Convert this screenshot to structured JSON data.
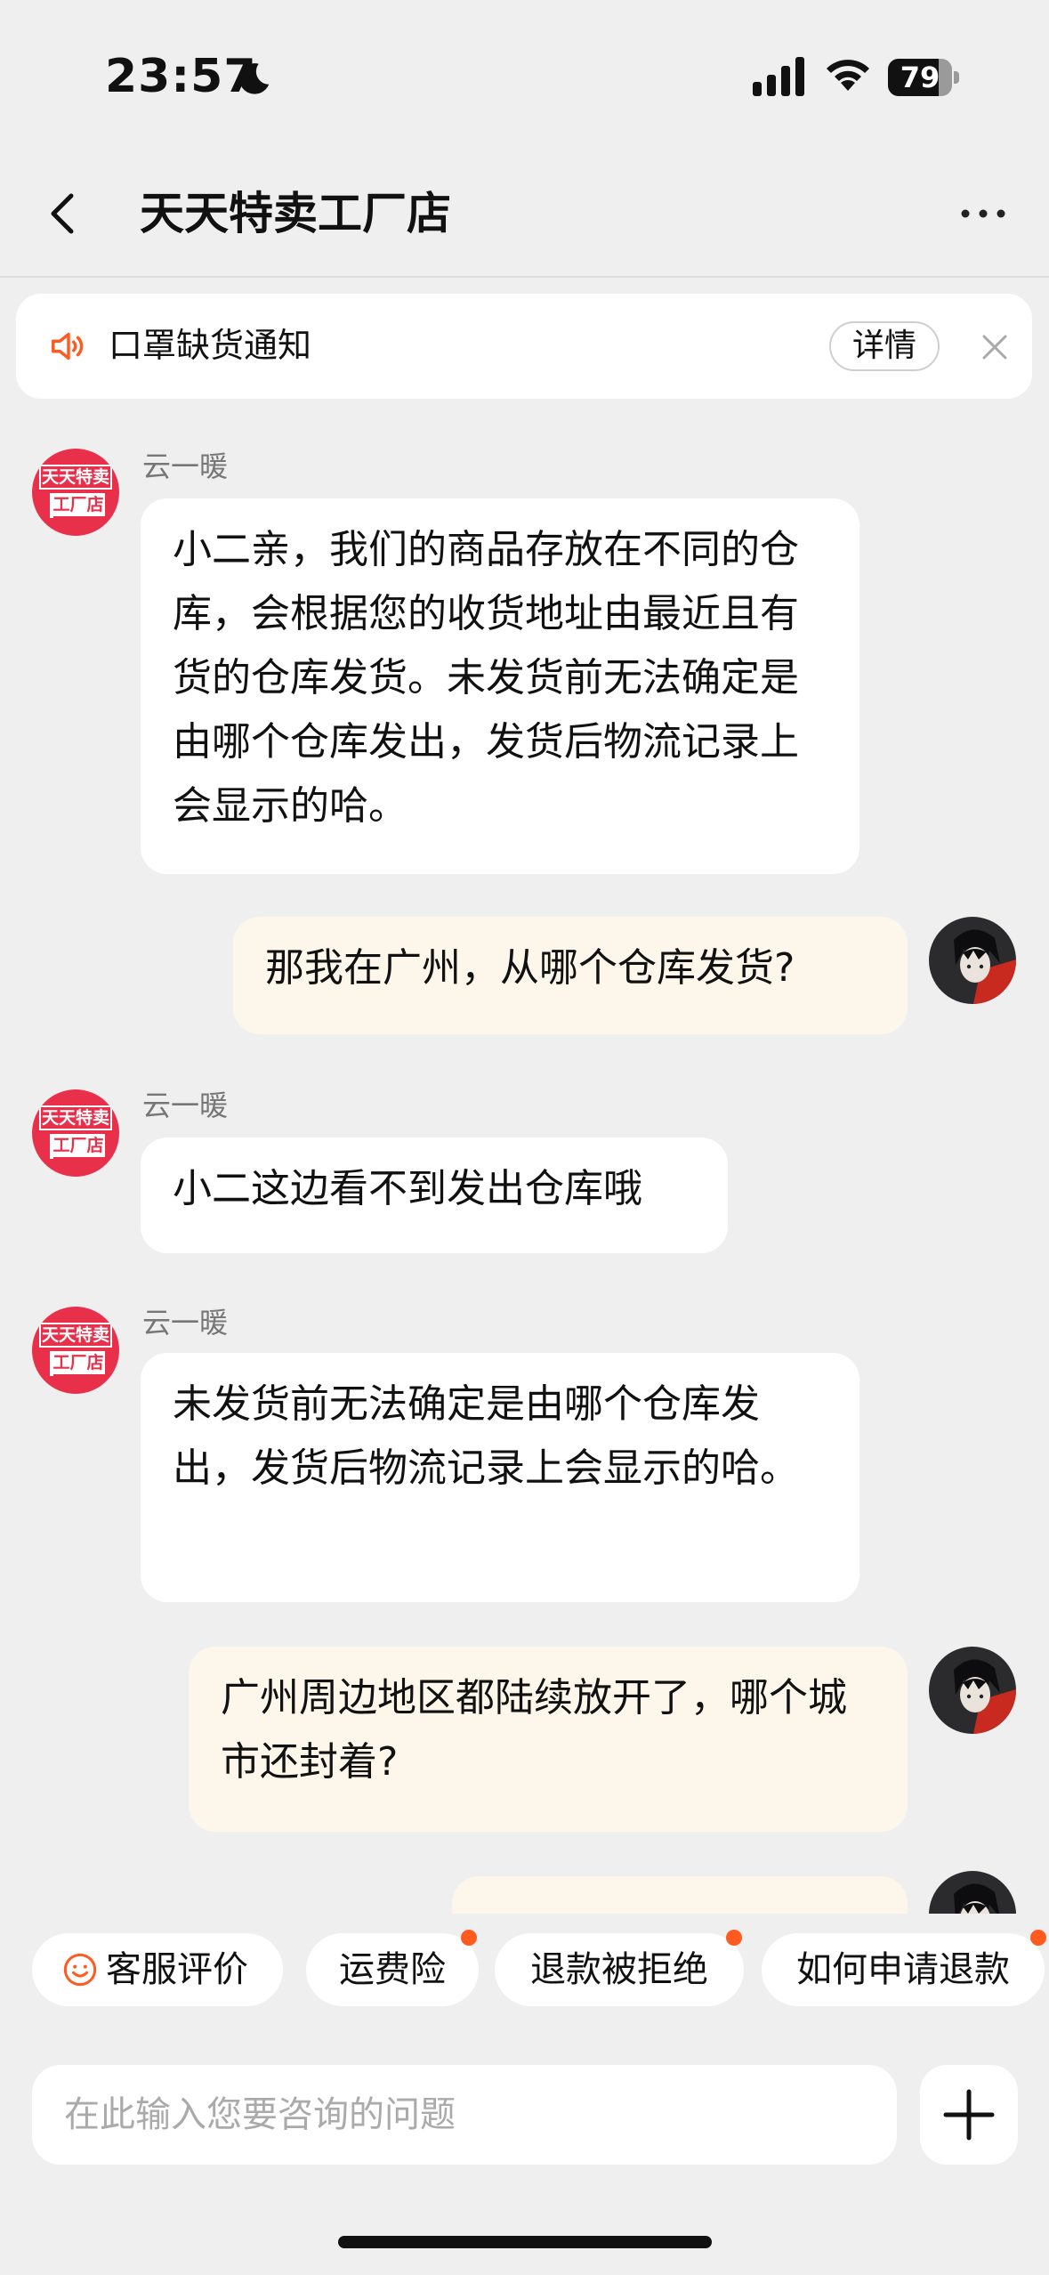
{
  "status_bar": {
    "time": "23:57",
    "battery": "79",
    "battery_level": 0.79,
    "icons": [
      "moon-icon",
      "signal-icon",
      "wifi-icon",
      "battery-icon"
    ]
  },
  "header": {
    "title": "天天特卖工厂店",
    "back_icon": "chevron-left-icon",
    "more_icon": "more-dots-icon"
  },
  "notice": {
    "text": "口罩缺货通知",
    "detail_label": "详情",
    "icon": "speaker-icon",
    "close_icon": "close-icon"
  },
  "shop": {
    "avatar_line1": "天天特卖",
    "avatar_line2": "工厂店"
  },
  "messages": [
    {
      "from": "agent",
      "sender": "云一暖",
      "text": "小二亲，我们的商品存放在不同的仓库，会根据您的收货地址由最近且有货的仓库发货。未发货前无法确定是由哪个仓库发出，发货后物流记录上会显示的哈。"
    },
    {
      "from": "user",
      "text": "那我在广州，从哪个仓库发货?"
    },
    {
      "from": "agent",
      "sender": "云一暖",
      "text": "小二这边看不到发出仓库哦"
    },
    {
      "from": "agent",
      "sender": "云一暖",
      "text": "未发货前无法确定是由哪个仓库发出，发货后物流记录上会显示的哈。"
    },
    {
      "from": "user",
      "text": "广州周边地区都陆续放开了，哪个城市还封着?"
    },
    {
      "from": "user",
      "text": ""
    }
  ],
  "quick_replies": [
    {
      "label": "客服评价",
      "icon": "smile-icon",
      "has_dot": false
    },
    {
      "label": "运费险",
      "has_dot": true
    },
    {
      "label": "退款被拒绝",
      "has_dot": true
    },
    {
      "label": "如何申请退款",
      "has_dot": true
    }
  ],
  "input": {
    "placeholder": "在此输入您要咨询的问题",
    "plus_icon": "plus-icon"
  },
  "colors": {
    "user_bubble": "#fdf6ea",
    "shop_avatar": "#e8304a",
    "notice_icon": "#ff5a1f",
    "dot": "#ff5a1f"
  }
}
